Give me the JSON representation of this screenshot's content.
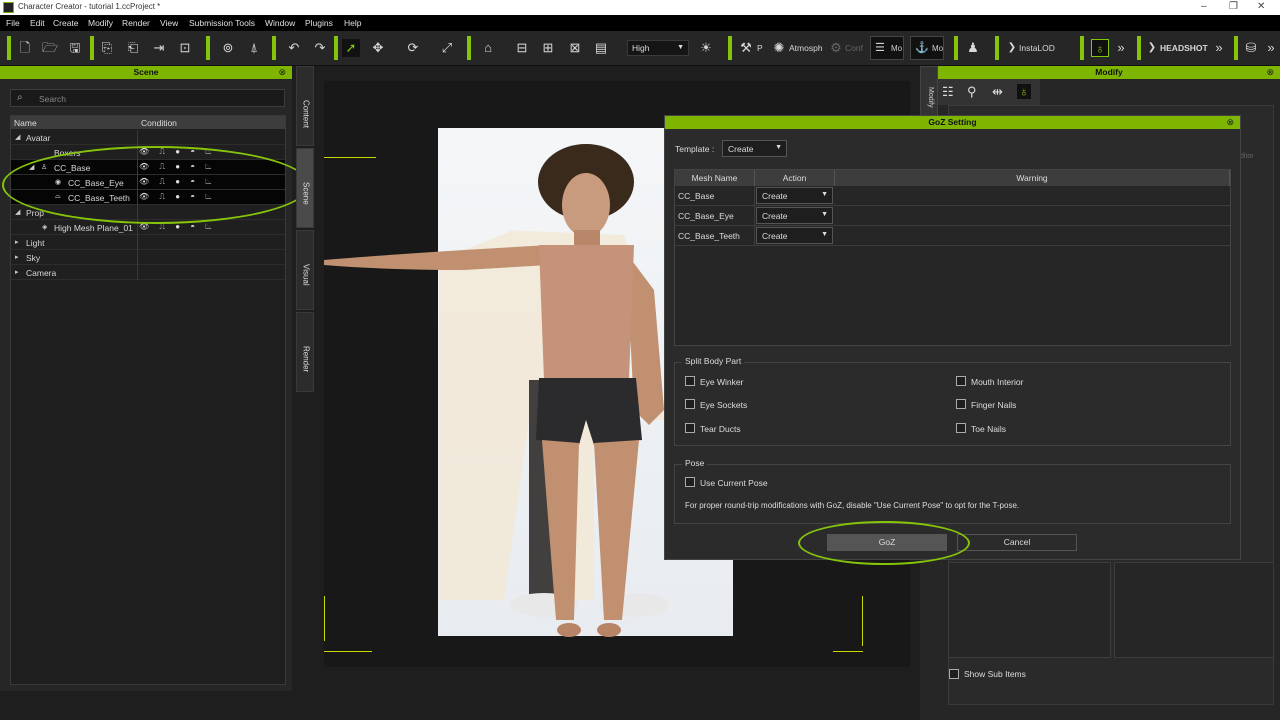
{
  "window": {
    "title": "Character Creator - tutorial 1.ccProject *"
  },
  "menu": [
    "File",
    "Edit",
    "Create",
    "Modify",
    "Render",
    "View",
    "Submission Tools",
    "Window",
    "Plugins",
    "Help"
  ],
  "toolbar": {
    "quality": "High",
    "p_label": "P",
    "atmosphere_label": "Atmosph",
    "conf_label": "Conf",
    "mo_label": "Mo",
    "mo2_label": "Mo",
    "instalod_label": "InstaLOD",
    "headshot_label": "HEADSHOT"
  },
  "scene": {
    "title": "Scene",
    "search_placeholder": "Search",
    "columns": [
      "Name",
      "Condition"
    ],
    "rows": [
      {
        "label": "Avatar",
        "expander": "◢",
        "indent": 0
      },
      {
        "label": "Boxers",
        "indent": 2
      },
      {
        "label": "CC_Base",
        "expander": "◢",
        "indent": 1
      },
      {
        "label": "CC_Base_Eye",
        "indent": 3
      },
      {
        "label": "CC_Base_Teeth",
        "indent": 3
      },
      {
        "label": "Prop",
        "expander": "◢",
        "indent": 0
      },
      {
        "label": "High Mesh Plane_01",
        "indent": 2
      },
      {
        "label": "Light",
        "expander": "▸",
        "indent": 0
      },
      {
        "label": "Sky",
        "expander": "▸",
        "indent": 0
      },
      {
        "label": "Camera",
        "expander": "▸",
        "indent": 0
      }
    ]
  },
  "side_tabs": [
    "Content",
    "Scene",
    "Visual",
    "Render"
  ],
  "modify": {
    "title": "Modify",
    "tab_label": "Modify",
    "editor_label": "ditor",
    "show_sub_items": "Show Sub Items"
  },
  "dialog": {
    "title": "GoZ Setting",
    "template_label": "Template :",
    "template_value": "Create",
    "columns": [
      "Mesh Name",
      "Action",
      "Warning"
    ],
    "meshes": [
      {
        "name": "CC_Base",
        "action": "Create",
        "warning": ""
      },
      {
        "name": "CC_Base_Eye",
        "action": "Create",
        "warning": ""
      },
      {
        "name": "CC_Base_Teeth",
        "action": "Create",
        "warning": ""
      }
    ],
    "split_title": "Split Body Part",
    "split_items": [
      "Eye Winker",
      "Mouth Interior",
      "Eye Sockets",
      "Finger Nails",
      "Tear Ducts",
      "Toe Nails"
    ],
    "pose_title": "Pose",
    "use_current_pose": "Use Current Pose",
    "pose_note": "For proper round-trip modifications with GoZ, disable \"Use Current Pose\" to opt for the T-pose.",
    "goz_button": "GoZ",
    "cancel_button": "Cancel"
  },
  "colors": {
    "accent": "#7db500",
    "highlight_ellipse": "#86c40a"
  }
}
